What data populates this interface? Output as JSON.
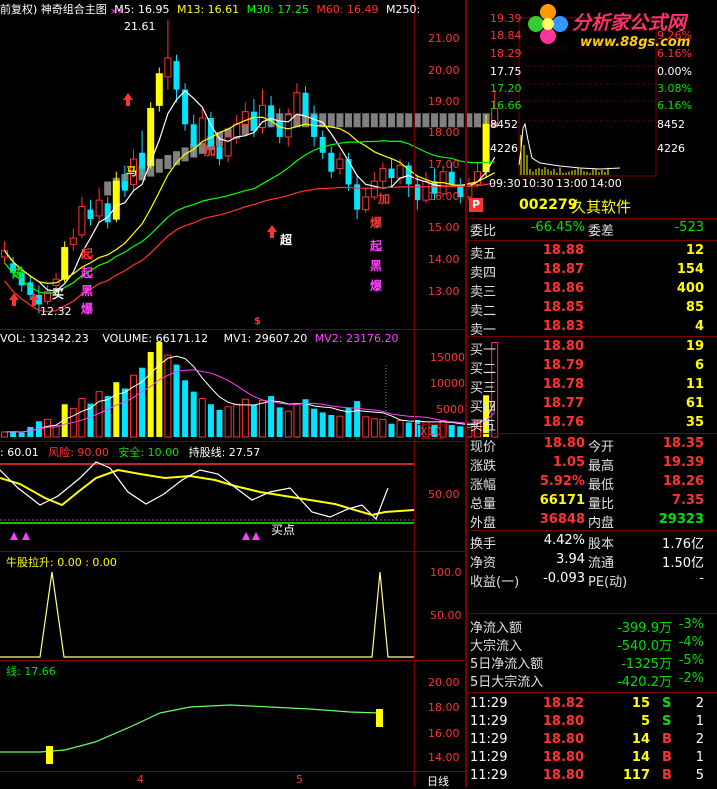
{
  "header": {
    "indicator_name": "前复权) 神奇组合主图",
    "ma": [
      {
        "label": "M5: 16.95",
        "color": "#ffffff"
      },
      {
        "label": "M13: 16.61",
        "color": "#ffff00"
      },
      {
        "label": "M30: 17.25",
        "color": "#00ff00"
      },
      {
        "label": "M60: 16.49",
        "color": "#ff3232"
      },
      {
        "label": "M250:",
        "color": "#ffffff"
      }
    ]
  },
  "price_axis": [
    "21.00",
    "20.00",
    "19.00",
    "18.00",
    "17.00",
    "16.00",
    "15.00",
    "14.00",
    "13.00"
  ],
  "price_markers": {
    "high": "21.61",
    "low": "12.32"
  },
  "signals": {
    "buy": "买",
    "super": "超",
    "add1": "加",
    "add2": "加",
    "ma": "马",
    "left_col": [
      "起",
      "黑",
      "爆"
    ],
    "right_col": [
      "爆",
      "起",
      "黑",
      "爆"
    ],
    "dollar": "$",
    "left_edge": "进"
  },
  "volume": {
    "vol_label": "VOL: 132342.23",
    "volume_label": "VOLUME: 66171.12",
    "mv1": "MV1: 29607.20",
    "mv2": "MV2: 23176.20",
    "axis": [
      "15000",
      "10000",
      "5000"
    ],
    "unit": "X10"
  },
  "risk": {
    "val": ": 60.01",
    "risk": "风险: 90.00",
    "safe": "安全: 10.00",
    "hold": "持股线: 27.57",
    "axis": "50.00",
    "buy_point": "买点"
  },
  "bull": {
    "label": "牛股拉升: 0.00 : 0.00",
    "axis": [
      "100.0",
      "50.00"
    ]
  },
  "line_panel": {
    "label": "线: 17.66",
    "axis": [
      "20.00",
      "18.00",
      "16.00",
      "14.00"
    ]
  },
  "date_axis": {
    "m4": "4",
    "m5": "5",
    "period": "日线"
  },
  "mini_chart": {
    "left_axis": [
      "19.39",
      "18.84",
      "18.29",
      "17.75",
      "17.20",
      "16.66",
      "8452",
      "4226"
    ],
    "right_axis": [
      "9.26%",
      "6.16%",
      "3.08%",
      "0.00%",
      "3.08%",
      "6.16%",
      "8452",
      "4226"
    ],
    "time": [
      "09:30",
      "10:30",
      "13:00",
      "14:00"
    ]
  },
  "logo": {
    "title": "分析家公式网",
    "url": "www.88gs.com"
  },
  "stock": {
    "badge": "P",
    "code": "002279",
    "name": "久其软件"
  },
  "ratio": {
    "l1": "委比",
    "v1": "-66.45%",
    "l2": "委差",
    "v2": "-523"
  },
  "asks": [
    {
      "label": "卖五",
      "price": "18.88",
      "vol": "12"
    },
    {
      "label": "卖四",
      "price": "18.87",
      "vol": "154"
    },
    {
      "label": "卖三",
      "price": "18.86",
      "vol": "400"
    },
    {
      "label": "卖二",
      "price": "18.85",
      "vol": "85"
    },
    {
      "label": "卖一",
      "price": "18.83",
      "vol": "4"
    }
  ],
  "bids": [
    {
      "label": "买一",
      "price": "18.80",
      "vol": "19"
    },
    {
      "label": "买二",
      "price": "18.79",
      "vol": "6"
    },
    {
      "label": "买三",
      "price": "18.78",
      "vol": "11"
    },
    {
      "label": "买四",
      "price": "18.77",
      "vol": "61"
    },
    {
      "label": "买五",
      "price": "18.76",
      "vol": "35"
    }
  ],
  "stats": [
    {
      "l1": "现价",
      "v1": "18.80",
      "c1": "#ff3232",
      "l2": "今开",
      "v2": "18.35",
      "c2": "#ff3232"
    },
    {
      "l1": "涨跌",
      "v1": "1.05",
      "c1": "#ff3232",
      "l2": "最高",
      "v2": "19.39",
      "c2": "#ff3232"
    },
    {
      "l1": "涨幅",
      "v1": "5.92%",
      "c1": "#ff3232",
      "l2": "最低",
      "v2": "18.26",
      "c2": "#ff3232"
    },
    {
      "l1": "总量",
      "v1": "66171",
      "c1": "#ffff00",
      "l2": "量比",
      "v2": "7.35",
      "c2": "#ff3232"
    },
    {
      "l1": "外盘",
      "v1": "36848",
      "c1": "#ff3232",
      "l2": "内盘",
      "v2": "29323",
      "c2": "#00e000"
    }
  ],
  "stats2": [
    {
      "l1": "换手",
      "v1": "4.42%",
      "l2": "股本",
      "v2": "1.76亿"
    },
    {
      "l1": "净资",
      "v1": "3.94",
      "l2": "流通",
      "v2": "1.50亿"
    },
    {
      "l1": "收益(一)",
      "v1": "-0.093",
      "l2": "PE(动)",
      "v2": "-"
    }
  ],
  "flows": [
    {
      "l": "净流入额",
      "v": "-399.9万",
      "p": "-3%"
    },
    {
      "l": "大宗流入",
      "v": "-540.0万",
      "p": "-4%"
    },
    {
      "l": "5日净流入额",
      "v": "-1325万",
      "p": "-5%"
    },
    {
      "l": "5日大宗流入",
      "v": "-420.2万",
      "p": "-2%"
    }
  ],
  "ticks": [
    {
      "t": "11:29",
      "p": "18.82",
      "v": "15",
      "s": "S",
      "n": "2"
    },
    {
      "t": "11:29",
      "p": "18.80",
      "v": "5",
      "s": "S",
      "n": "1"
    },
    {
      "t": "11:29",
      "p": "18.80",
      "v": "14",
      "s": "B",
      "n": "2"
    },
    {
      "t": "11:29",
      "p": "18.80",
      "v": "14",
      "s": "B",
      "n": "1"
    },
    {
      "t": "11:29",
      "p": "18.80",
      "v": "117",
      "s": "B",
      "n": "5"
    }
  ]
}
